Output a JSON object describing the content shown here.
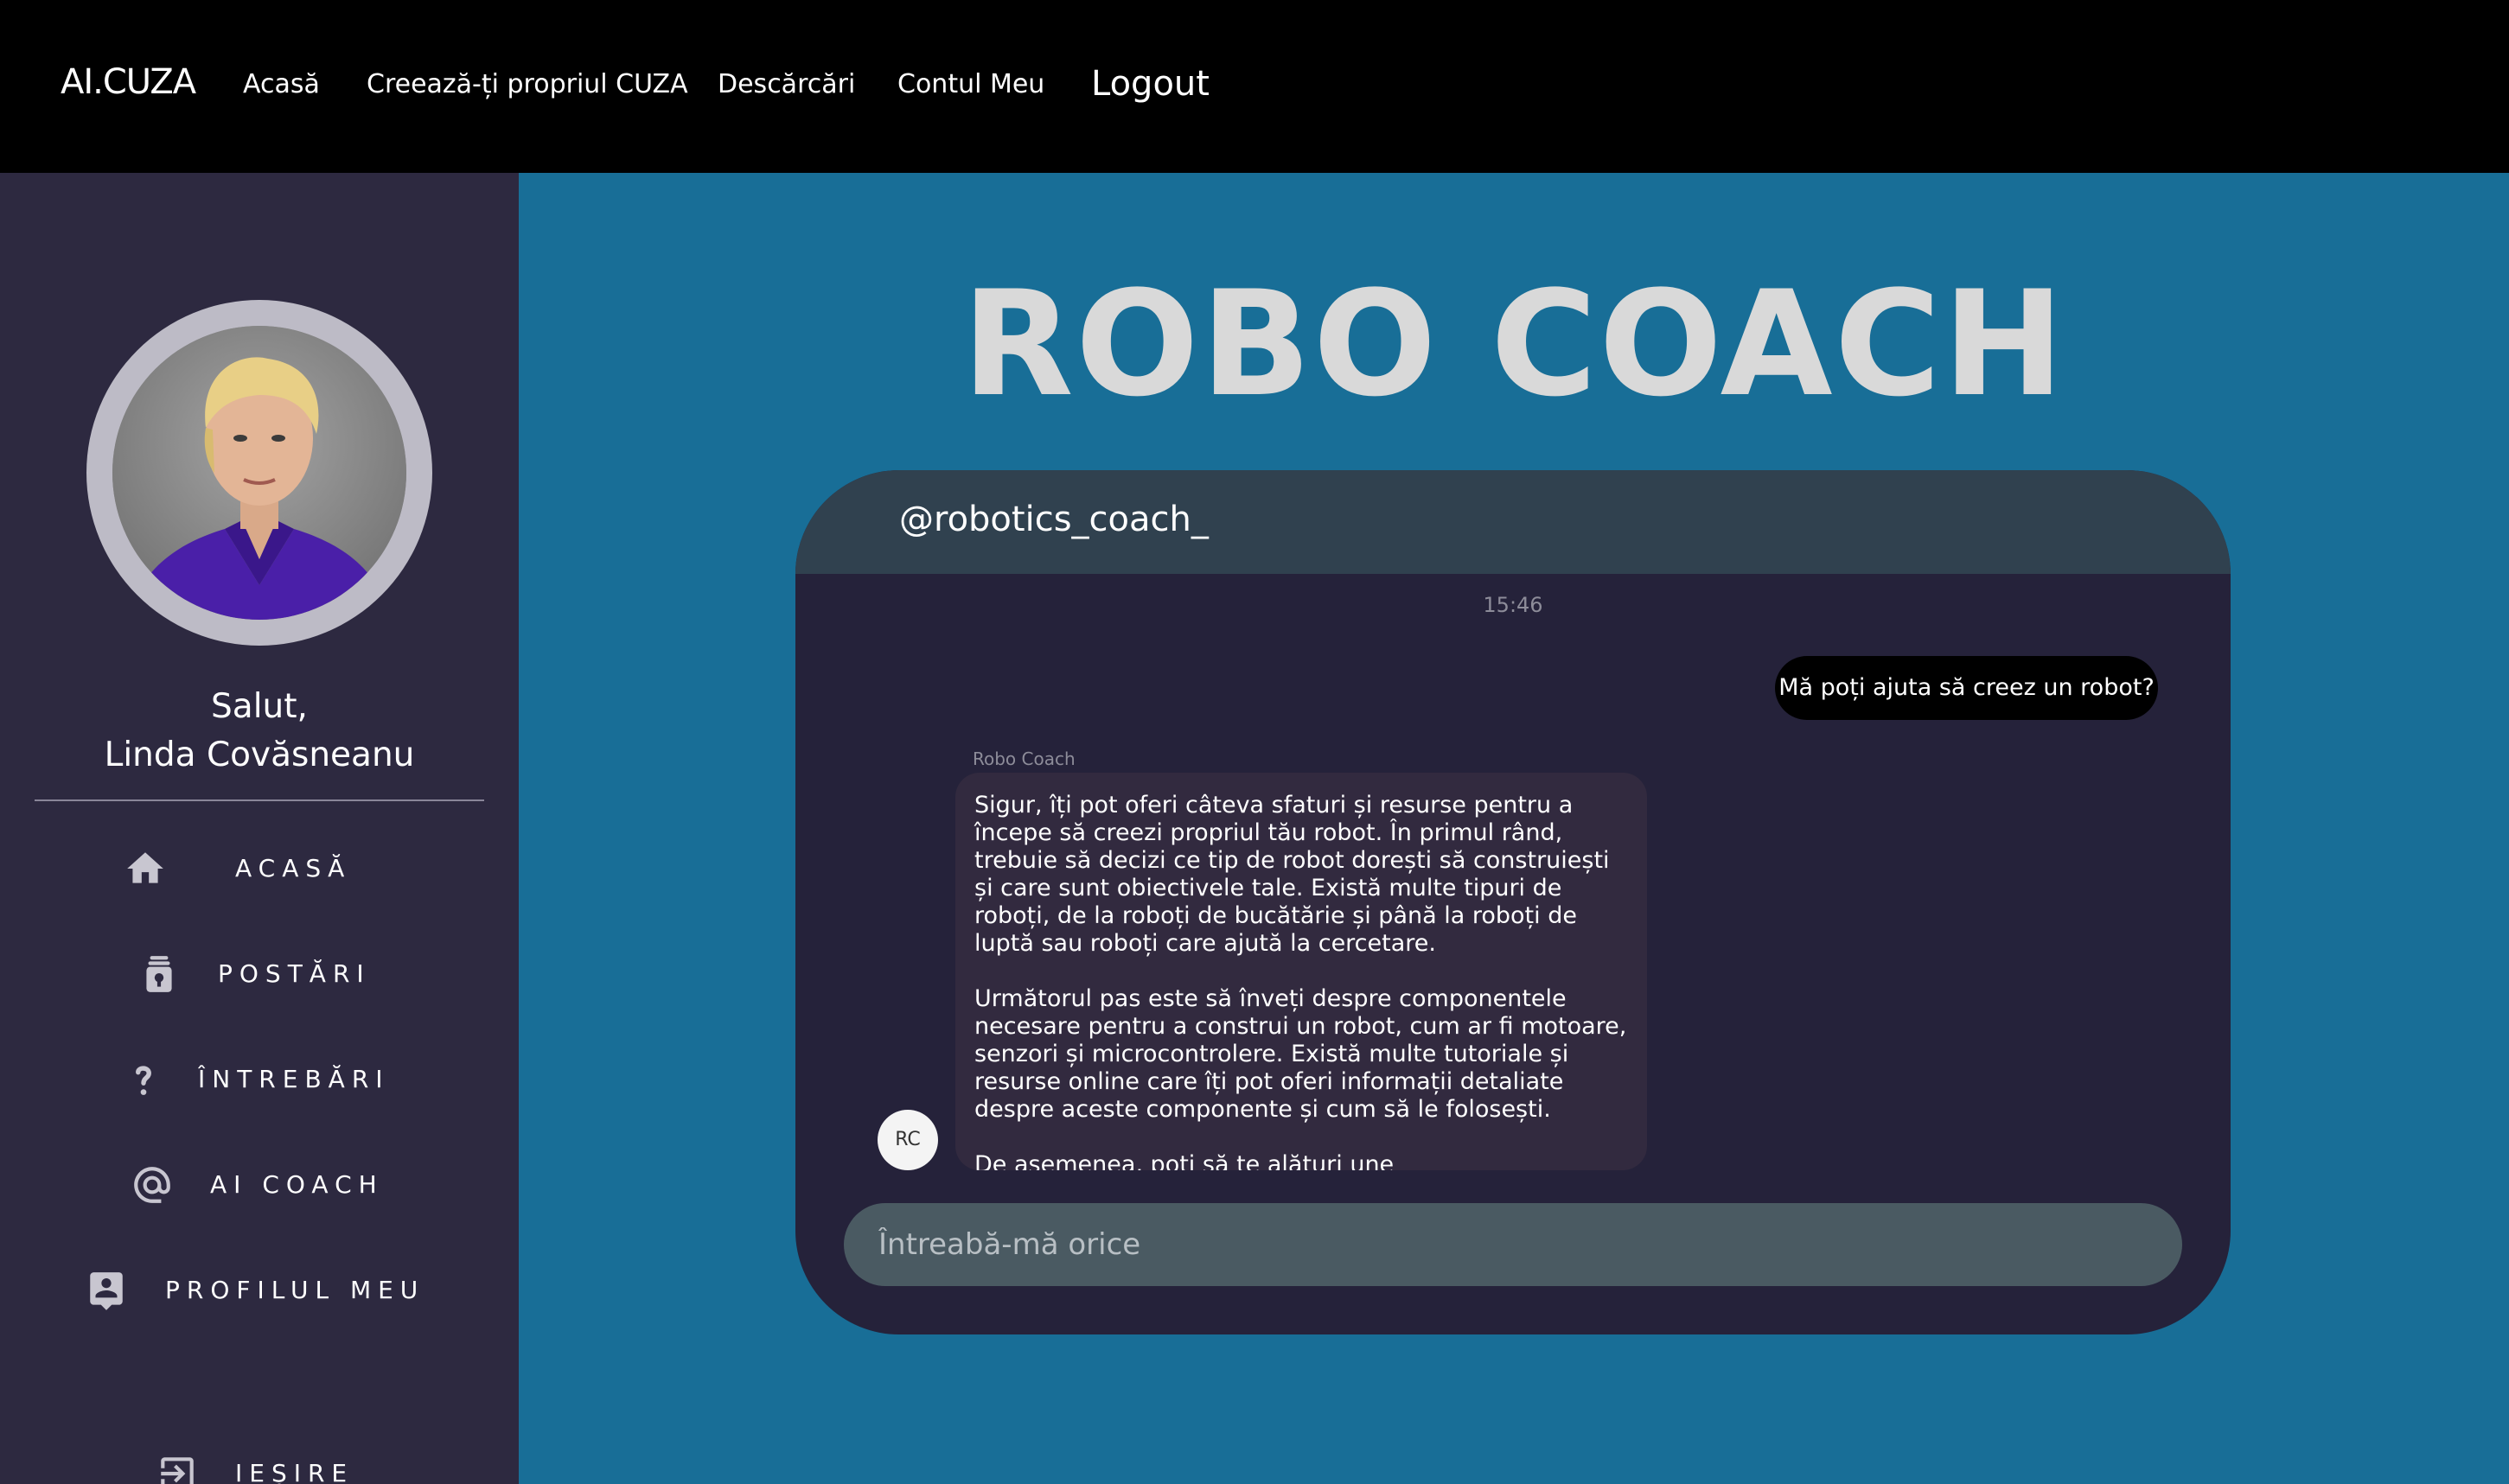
{
  "nav": {
    "brand": "AI.CUZA",
    "links": [
      "Acasă",
      "Creează-ți propriul CUZA",
      "Descărcări",
      "Contul Meu"
    ],
    "logout": "Logout"
  },
  "sidebar": {
    "greeting": "Salut,",
    "user_name": "Linda Covăsneanu",
    "items": [
      {
        "label": "ACASĂ",
        "icon": "home-icon"
      },
      {
        "label": "POSTĂRI",
        "icon": "posts-icon"
      },
      {
        "label": "ÎNTREBĂRI",
        "icon": "question-icon"
      },
      {
        "label": "AI COACH",
        "icon": "at-icon"
      },
      {
        "label": "PROFILUL MEU",
        "icon": "profile-icon"
      },
      {
        "label": "IEȘIRE",
        "icon": "exit-icon"
      }
    ]
  },
  "main": {
    "title": "ROBO COACH"
  },
  "chat": {
    "handle": "@robotics_coach_",
    "timestamp": "15:46",
    "user_message": "Mă poți ajuta să creez un robot?",
    "bot_name": "Robo Coach",
    "bot_avatar_initials": "RC",
    "bot_paragraphs": [
      "Sigur, îți pot oferi câteva sfaturi și resurse pentru a începe să creezi propriul tău robot. În primul rând, trebuie să decizi ce tip de robot dorești să construiești și care sunt obiectivele tale. Există multe tipuri de roboți, de la roboți de bucătărie și până la roboți de luptă sau roboți care ajută la cercetare.",
      "Următorul pas este să înveți despre componentele necesare pentru a construi un robot, cum ar fi motoare, senzori și microcontrolere. Există multe tutoriale și resurse online care îți pot oferi informații detaliate despre aceste componente și cum să le folosești.",
      "De asemenea, poți să te alături une"
    ],
    "input_placeholder": "Întreabă-mă orice"
  },
  "colors": {
    "navbar": "#000000",
    "sidebar": "#2d2940",
    "main_bg": "#186e97",
    "chat_bg": "#25223a",
    "chat_header": "#30414f",
    "bot_bubble": "#322a3f",
    "input_bg": "#4a5a62"
  }
}
